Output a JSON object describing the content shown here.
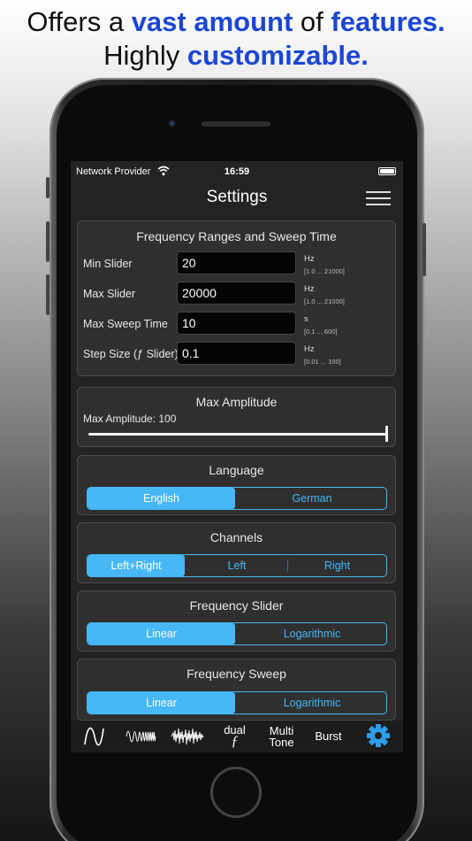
{
  "headline": {
    "line1_a": "Offers a ",
    "line1_b": "vast amount",
    "line1_c": " of ",
    "line1_d": "features.",
    "line2_a": "Highly ",
    "line2_b": "customizable."
  },
  "statusbar": {
    "carrier": "Network Provider",
    "time": "16:59"
  },
  "nav": {
    "title": "Settings",
    "menu_icon": "hamburger-icon"
  },
  "ranges": {
    "title": "Frequency Ranges and Sweep Time",
    "fields": [
      {
        "label": "Min Slider",
        "value": "20",
        "unit": "Hz",
        "range": "[1.0 ... 21000]"
      },
      {
        "label": "Max Slider",
        "value": "20000",
        "unit": "Hz",
        "range": "[1.0 ... 21000]"
      },
      {
        "label": "Max Sweep Time",
        "value": "10",
        "unit": "s",
        "range": "[0.1 ... 600]"
      },
      {
        "label": "Step Size (ƒ Slider)",
        "value": "0.1",
        "unit": "Hz",
        "range": "[0.01 ... 100]"
      }
    ]
  },
  "amplitude": {
    "title": "Max Amplitude",
    "label": "Max Amplitude: 100",
    "level": 1.0
  },
  "language": {
    "title": "Language",
    "options": [
      "English",
      "German"
    ],
    "selected": "English"
  },
  "channels": {
    "title": "Channels",
    "options": [
      "Left+Right",
      "Left",
      "Right"
    ],
    "selected": "Left+Right"
  },
  "freq_slider": {
    "title": "Frequency Slider",
    "options": [
      "Linear",
      "Logarithmic"
    ],
    "selected": "Linear"
  },
  "freq_sweep": {
    "title": "Frequency Sweep",
    "options": [
      "Linear",
      "Logarithmic"
    ],
    "selected": "Linear"
  },
  "tabs": [
    {
      "name": "sine",
      "icon": "sine-wave-icon"
    },
    {
      "name": "sweep",
      "icon": "sweep-wave-icon"
    },
    {
      "name": "noise",
      "icon": "noise-wave-icon"
    },
    {
      "name": "dual",
      "line1": "dual",
      "line2": "ƒ"
    },
    {
      "name": "multitone",
      "line1": "Multi",
      "line2": "Tone"
    },
    {
      "name": "burst",
      "label": "Burst"
    },
    {
      "name": "settings",
      "icon": "gear-icon",
      "active": true
    }
  ],
  "colors": {
    "accent": "#47b7f5",
    "headline_highlight": "#1a46d8",
    "active_tab": "#2f9de8"
  }
}
